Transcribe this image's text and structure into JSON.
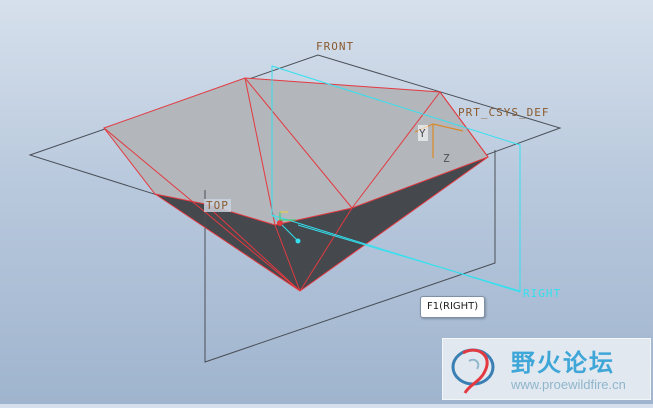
{
  "viewport": {
    "planes": {
      "front": "FRONT",
      "top": "TOP",
      "right": "RIGHT"
    },
    "csys": {
      "name": "PRT_CSYS_DEF",
      "axis_y": "Y",
      "axis_z": "Z"
    }
  },
  "tooltip": {
    "text": "F1(RIGHT)"
  },
  "watermark": {
    "brand": "野火论坛",
    "url": "www.proewildfire.cn"
  },
  "colors": {
    "plane_gray": "#4a4f57",
    "datum_cyan": "#34e0ee",
    "edge_red": "#e23a40",
    "label_brown": "#8a5a2e",
    "csys_orange": "#d98a2a",
    "face_light": "#b3b6bb",
    "face_dark": "#45484d"
  }
}
